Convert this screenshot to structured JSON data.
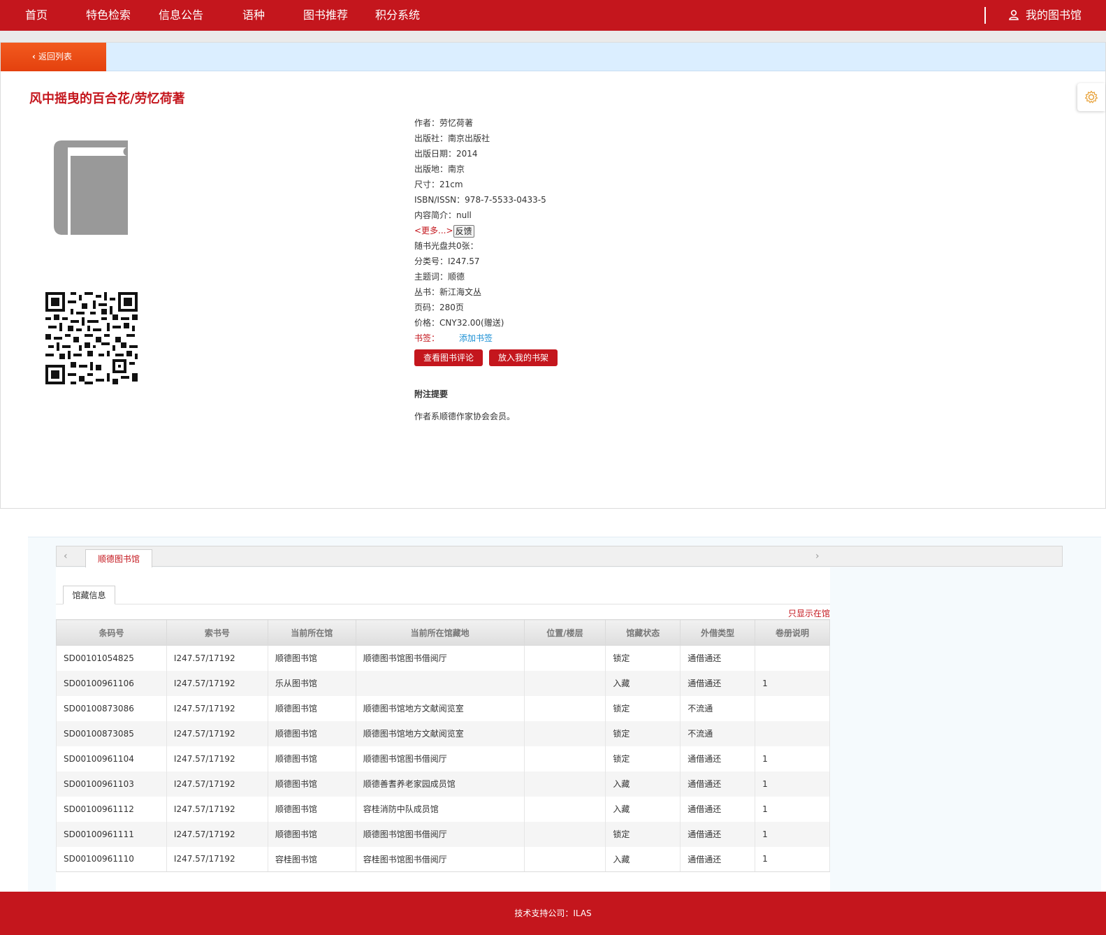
{
  "nav": {
    "items": [
      "首页",
      "特色检索",
      "信息公告",
      "语种",
      "图书推荐",
      "积分系统"
    ],
    "my_library": "我的图书馆"
  },
  "back_button": "返回列表",
  "book": {
    "title": "风中摇曳的百合花/劳忆荷著",
    "fields": [
      {
        "label": "作者：",
        "value": "劳忆荷著"
      },
      {
        "label": "出版社：",
        "value": "南京出版社"
      },
      {
        "label": "出版日期：",
        "value": "2014"
      },
      {
        "label": "出版地：",
        "value": "南京"
      },
      {
        "label": "尺寸：",
        "value": "21cm"
      },
      {
        "label": "ISBN/ISSN：",
        "value": "978-7-5533-0433-5"
      },
      {
        "label": "内容简介：",
        "value": "null"
      }
    ],
    "more_link": "<更多...>",
    "feedback": "反馈",
    "fields2": [
      {
        "label": "随书光盘共0张：",
        "value": ""
      },
      {
        "label": "分类号：",
        "value": "I247.57"
      },
      {
        "label": "主题词：",
        "value": "顺德"
      },
      {
        "label": "丛书：",
        "value": "新江海文丛"
      },
      {
        "label": "页码：",
        "value": "280页"
      },
      {
        "label": "价格：",
        "value": "CNY32.00(赠送)"
      }
    ],
    "bookmark_label": "书签：",
    "bookmark_add": "添加书签",
    "btn_reviews": "查看图书评论",
    "btn_shelf": "放入我的书架",
    "note_title": "附注提要",
    "note_text": "作者系顺德作家协会会员。"
  },
  "holdings": {
    "tab": "顺德图书馆",
    "subtab": "馆藏信息",
    "only_in_library": "只显示在馆",
    "columns": [
      "条码号",
      "索书号",
      "当前所在馆",
      "当前所在馆藏地",
      "位置/楼层",
      "馆藏状态",
      "外借类型",
      "卷册说明"
    ],
    "rows": [
      [
        "SD00101054825",
        "I247.57/17192",
        "顺德图书馆",
        "顺德图书馆图书借阅厅",
        "",
        "锁定",
        "通借通还",
        ""
      ],
      [
        "SD00100961106",
        "I247.57/17192",
        "乐从图书馆",
        "",
        "",
        "入藏",
        "通借通还",
        "1"
      ],
      [
        "SD00100873086",
        "I247.57/17192",
        "顺德图书馆",
        "顺德图书馆地方文献阅览室",
        "",
        "锁定",
        "不流通",
        ""
      ],
      [
        "SD00100873085",
        "I247.57/17192",
        "顺德图书馆",
        "顺德图书馆地方文献阅览室",
        "",
        "锁定",
        "不流通",
        ""
      ],
      [
        "SD00100961104",
        "I247.57/17192",
        "顺德图书馆",
        "顺德图书馆图书借阅厅",
        "",
        "锁定",
        "通借通还",
        "1"
      ],
      [
        "SD00100961103",
        "I247.57/17192",
        "顺德图书馆",
        "顺德善耆养老家园成员馆",
        "",
        "入藏",
        "通借通还",
        "1"
      ],
      [
        "SD00100961112",
        "I247.57/17192",
        "顺德图书馆",
        "容桂消防中队成员馆",
        "",
        "入藏",
        "通借通还",
        "1"
      ],
      [
        "SD00100961111",
        "I247.57/17192",
        "顺德图书馆",
        "顺德图书馆图书借阅厅",
        "",
        "锁定",
        "通借通还",
        "1"
      ],
      [
        "SD00100961110",
        "I247.57/17192",
        "容桂图书馆",
        "容桂图书馆图书借阅厅",
        "",
        "入藏",
        "通借通还",
        "1"
      ]
    ]
  },
  "footer": "技术支持公司：ILAS",
  "colors": {
    "brand_red": "#c4161d",
    "back_orange": "#e4410e",
    "link_blue": "#1a8fd4"
  },
  "icons": {
    "user": "user-icon",
    "gear": "gear-icon",
    "book": "book-cover-icon",
    "qr": "qr-code-icon"
  }
}
